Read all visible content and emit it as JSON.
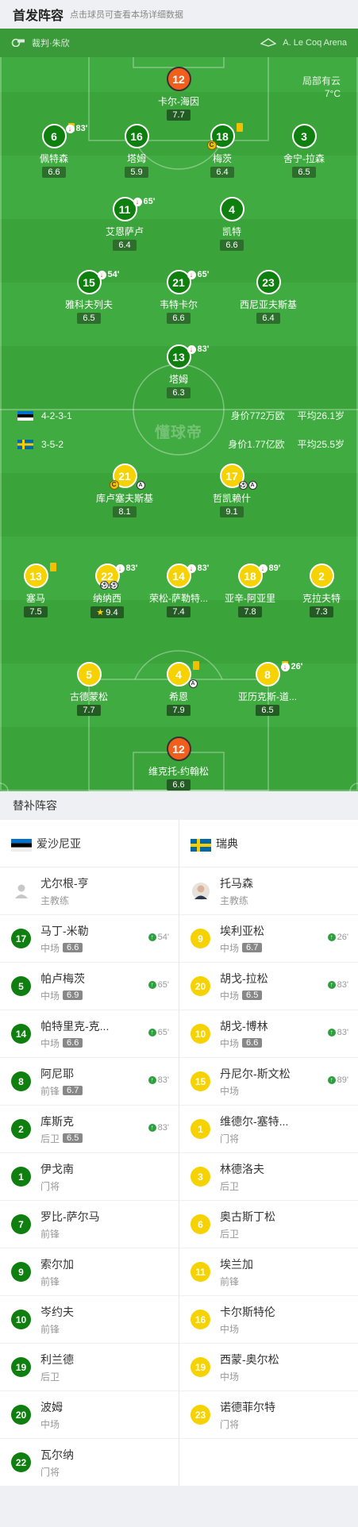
{
  "header": {
    "title": "首发阵容",
    "subtitle": "点击球员可查看本场详细数据"
  },
  "pitch_info": {
    "referee": "裁判·朱欣",
    "venue": "A. Le Coq Arena",
    "weather": "局部有云",
    "temperature": "7°C",
    "watermark": "懂球帝"
  },
  "colors": {
    "pitch": "#40ab40",
    "home_badge": "#0f7f0f",
    "away_badge": "#f5d200",
    "goalkeeper": "#f05f1e",
    "sub_arrow": "#2e9e3e"
  },
  "home_team": {
    "name": "爱沙尼亚",
    "formation": "4-2-3-1",
    "value": "身价772万欧",
    "avg_age": "平均26.1岁"
  },
  "away_team": {
    "name": "瑞典",
    "formation": "3-5-2",
    "value": "身价1.77亿欧",
    "avg_age": "平均25.5岁"
  },
  "home_lineup": [
    {
      "num": "12",
      "name": "卡尔-海因",
      "rating": "7.7"
    },
    {
      "num": "6",
      "name": "佩特森",
      "rating": "6.6",
      "sub": "83'"
    },
    {
      "num": "16",
      "name": "塔姆",
      "rating": "5.9"
    },
    {
      "num": "18",
      "name": "梅茨",
      "rating": "6.4"
    },
    {
      "num": "3",
      "name": "舍宁-拉森",
      "rating": "6.5"
    },
    {
      "num": "11",
      "name": "艾恩萨卢",
      "rating": "6.4",
      "sub": "65'"
    },
    {
      "num": "4",
      "name": "凯特",
      "rating": "6.6"
    },
    {
      "num": "15",
      "name": "雅科夫列夫",
      "rating": "6.5",
      "sub": "54'"
    },
    {
      "num": "21",
      "name": "韦特卡尔",
      "rating": "6.6",
      "sub": "65'"
    },
    {
      "num": "23",
      "name": "西尼亚夫斯基",
      "rating": "6.4"
    },
    {
      "num": "13",
      "name": "塔姆",
      "rating": "6.3",
      "sub": "83'"
    }
  ],
  "away_lineup": [
    {
      "num": "21",
      "name": "库卢塞夫斯基",
      "rating": "8.1"
    },
    {
      "num": "17",
      "name": "哲凯赖什",
      "rating": "9.1"
    },
    {
      "num": "13",
      "name": "塞马",
      "rating": "7.5"
    },
    {
      "num": "22",
      "name": "纳纳西",
      "rating": "9.4",
      "sub": "83'"
    },
    {
      "num": "14",
      "name": "荣松-萨勒特...",
      "rating": "7.4",
      "sub": "83'"
    },
    {
      "num": "18",
      "name": "亚辛-阿亚里",
      "rating": "7.8",
      "sub": "89'"
    },
    {
      "num": "2",
      "name": "克拉夫特",
      "rating": "7.3"
    },
    {
      "num": "5",
      "name": "古德蒙松",
      "rating": "7.7"
    },
    {
      "num": "4",
      "name": "希恩",
      "rating": "7.9"
    },
    {
      "num": "8",
      "name": "亚历克斯-道...",
      "rating": "6.5",
      "sub": "26'"
    },
    {
      "num": "12",
      "name": "维克托-约翰松",
      "rating": "6.6"
    }
  ],
  "subs_section": {
    "title": "替补阵容"
  },
  "home_bench": [
    {
      "num": "",
      "name": "尤尔根-亨",
      "pos": "主教练"
    },
    {
      "num": "17",
      "name": "马丁-米勒",
      "pos": "中场",
      "rating": "6.6",
      "minute": "54'"
    },
    {
      "num": "5",
      "name": "帕卢梅茨",
      "pos": "中场",
      "rating": "6.9",
      "minute": "65'"
    },
    {
      "num": "14",
      "name": "帕特里克-克...",
      "pos": "中场",
      "rating": "6.6",
      "minute": "65'"
    },
    {
      "num": "8",
      "name": "阿尼耶",
      "pos": "前锋",
      "rating": "6.7",
      "minute": "83'"
    },
    {
      "num": "2",
      "name": "库斯克",
      "pos": "后卫",
      "rating": "6.5",
      "minute": "83'"
    },
    {
      "num": "1",
      "name": "伊戈南",
      "pos": "门将"
    },
    {
      "num": "7",
      "name": "罗比-萨尔马",
      "pos": "前锋"
    },
    {
      "num": "9",
      "name": "索尔加",
      "pos": "前锋"
    },
    {
      "num": "10",
      "name": "岑约夫",
      "pos": "前锋"
    },
    {
      "num": "19",
      "name": "利兰德",
      "pos": "后卫"
    },
    {
      "num": "20",
      "name": "波姆",
      "pos": "中场"
    },
    {
      "num": "22",
      "name": "瓦尔纳",
      "pos": "门将"
    }
  ],
  "away_bench": [
    {
      "num": "",
      "name": "托马森",
      "pos": "主教练"
    },
    {
      "num": "9",
      "name": "埃利亚松",
      "pos": "中场",
      "rating": "6.7",
      "minute": "26'"
    },
    {
      "num": "20",
      "name": "胡戈-拉松",
      "pos": "中场",
      "rating": "6.5",
      "minute": "83'"
    },
    {
      "num": "10",
      "name": "胡戈-博林",
      "pos": "中场",
      "rating": "6.6",
      "minute": "83'"
    },
    {
      "num": "15",
      "name": "丹尼尔-斯文松",
      "pos": "中场",
      "minute": "89'"
    },
    {
      "num": "1",
      "name": "维德尔-塞特...",
      "pos": "门将"
    },
    {
      "num": "3",
      "name": "林德洛夫",
      "pos": "后卫"
    },
    {
      "num": "6",
      "name": "奥古斯丁松",
      "pos": "后卫"
    },
    {
      "num": "11",
      "name": "埃兰加",
      "pos": "前锋"
    },
    {
      "num": "16",
      "name": "卡尔斯特伦",
      "pos": "中场"
    },
    {
      "num": "19",
      "name": "西蒙-奥尔松",
      "pos": "中场"
    },
    {
      "num": "23",
      "name": "诺德菲尔特",
      "pos": "门将"
    }
  ]
}
